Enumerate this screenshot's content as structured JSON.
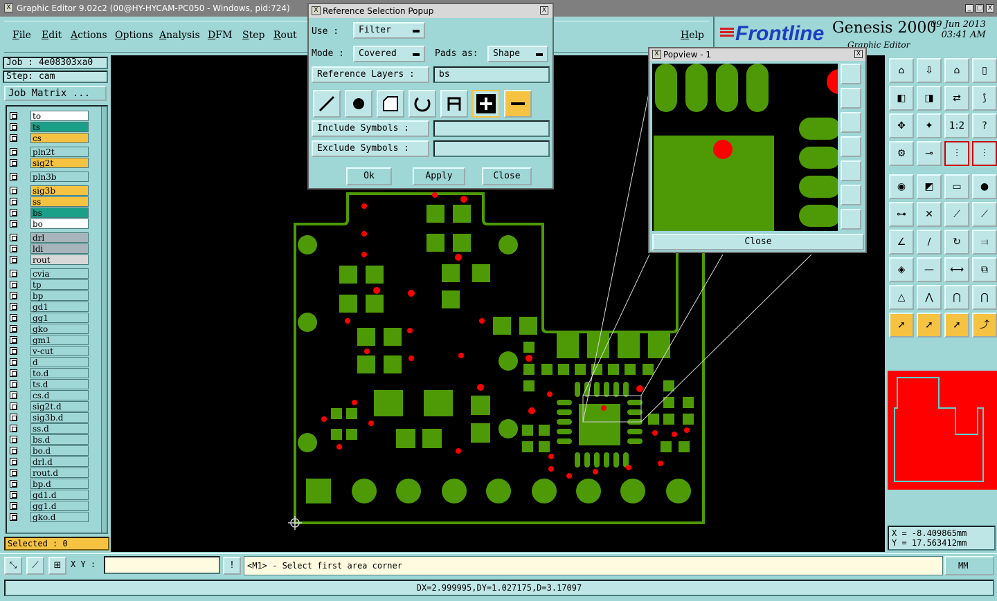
{
  "window": {
    "title": "Graphic Editor 9.02c2 (00@HY-HYCAM-PC050 - Windows, pid:724)",
    "icon_glyph": "X"
  },
  "window_buttons": {
    "minimize": "_",
    "maximize": "□",
    "close": "X"
  },
  "menu": [
    "File",
    "Edit",
    "Actions",
    "Options",
    "Analysis",
    "DFM",
    "Step",
    "Rout",
    "Help"
  ],
  "brand": {
    "logo": "Frontline",
    "product": "Genesis 2000",
    "subtitle": "Graphic Editor",
    "date": "09 Jun 2013",
    "time": "03:41 AM"
  },
  "job": {
    "job_line": "Job : 4e08303xa0",
    "step_line": "Step: cam",
    "matrix_button": "Job Matrix ..."
  },
  "layers": [
    {
      "name": "to",
      "color": "#ffffff"
    },
    {
      "name": "ts",
      "color": "#1aa088"
    },
    {
      "name": "cs",
      "color": "#f5c242"
    },
    {
      "name": "pln2t",
      "color": "#9fd6d6"
    },
    {
      "name": "sig2t",
      "color": "#f5c242"
    },
    {
      "name": "pln3b",
      "color": "#9fd6d6"
    },
    {
      "name": "sig3b",
      "color": "#f5c242"
    },
    {
      "name": "ss",
      "color": "#f5c242"
    },
    {
      "name": "bs",
      "color": "#1aa088"
    },
    {
      "name": "bo",
      "color": "#ffffff"
    },
    {
      "name": "drl",
      "color": "#a8b4bc"
    },
    {
      "name": "ldi",
      "color": "#a8b4bc"
    },
    {
      "name": "rout",
      "color": "#d8d8d8"
    },
    {
      "name": "cvia",
      "color": "#9fd6d6"
    },
    {
      "name": "tp",
      "color": "#9fd6d6"
    },
    {
      "name": "bp",
      "color": "#9fd6d6"
    },
    {
      "name": "gd1",
      "color": "#9fd6d6"
    },
    {
      "name": "gg1",
      "color": "#9fd6d6"
    },
    {
      "name": "gko",
      "color": "#9fd6d6"
    },
    {
      "name": "gm1",
      "color": "#9fd6d6"
    },
    {
      "name": "v-cut",
      "color": "#9fd6d6"
    },
    {
      "name": "d",
      "color": "#9fd6d6"
    },
    {
      "name": "to.d",
      "color": "#9fd6d6"
    },
    {
      "name": "ts.d",
      "color": "#9fd6d6"
    },
    {
      "name": "cs.d",
      "color": "#9fd6d6"
    },
    {
      "name": "sig2t.d",
      "color": "#9fd6d6"
    },
    {
      "name": "sig3b.d",
      "color": "#9fd6d6"
    },
    {
      "name": "ss.d",
      "color": "#9fd6d6"
    },
    {
      "name": "bs.d",
      "color": "#9fd6d6"
    },
    {
      "name": "bo.d",
      "color": "#9fd6d6"
    },
    {
      "name": "drl.d",
      "color": "#9fd6d6"
    },
    {
      "name": "rout.d",
      "color": "#9fd6d6"
    },
    {
      "name": "bp.d",
      "color": "#9fd6d6"
    },
    {
      "name": "gd1.d",
      "color": "#9fd6d6"
    },
    {
      "name": "gg1.d",
      "color": "#9fd6d6"
    },
    {
      "name": "gko.d",
      "color": "#9fd6d6"
    }
  ],
  "selected": "Selected : 0",
  "popup": {
    "title": "Reference Selection Popup",
    "use_label": "Use   :",
    "use_value": "Filter",
    "mode_label": "Mode  :",
    "mode_value": "Covered",
    "pads_label": "Pads as:",
    "pads_value": "Shape",
    "ref_layers_label": "Reference Layers :",
    "ref_layers_value": "bs",
    "include_label": "Include Symbols  :",
    "include_value": "",
    "exclude_label": "Exclude Symbols  :",
    "exclude_value": "",
    "ok": "Ok",
    "apply": "Apply",
    "close": "Close"
  },
  "popview": {
    "title": "Popview - 1",
    "close": "Close"
  },
  "coords": {
    "x": "X  =  -8.409865mm",
    "y": "Y  =  17.563412mm"
  },
  "bottom": {
    "xy_label": "X Y :",
    "xy_value": "",
    "prompt": "<M1> - Select first area corner",
    "units": "MM"
  },
  "status": "DX=2.999995,DY=1.027175,D=3.17097",
  "colors": {
    "copper": "#4e9a06",
    "drill": "#ff0000",
    "background": "#000000",
    "panel": "#9fd6d6"
  }
}
